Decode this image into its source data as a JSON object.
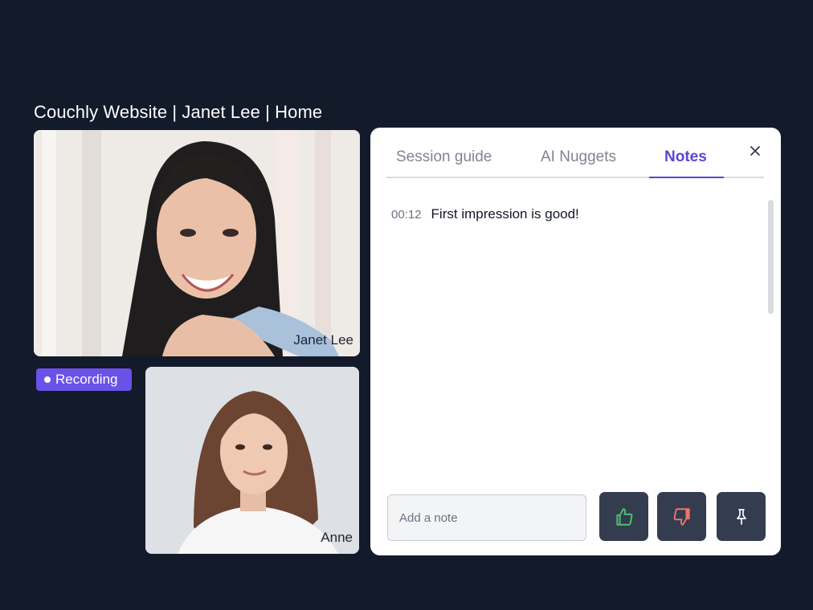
{
  "session": {
    "title": "Couchly Website | Janet Lee | Home"
  },
  "videos": {
    "main": {
      "name": "Janet Lee"
    },
    "small": {
      "name": "Anne"
    }
  },
  "recording": {
    "label": "Recording"
  },
  "panel": {
    "tabs": [
      {
        "label": "Session guide",
        "active": false
      },
      {
        "label": "AI Nuggets",
        "active": false
      },
      {
        "label": "Notes",
        "active": true
      }
    ],
    "notes": [
      {
        "time": "00:12",
        "text": "First impression is good!"
      }
    ],
    "input": {
      "placeholder": "Add a note",
      "value": ""
    },
    "icons": {
      "close": "close-icon",
      "thumbs_up": "thumbs-up-icon",
      "thumbs_down": "thumbs-down-icon",
      "pin": "pin-icon"
    }
  },
  "colors": {
    "background": "#131a2a",
    "accent": "#5b46d6",
    "recording": "#6a52e8",
    "button": "#343c4f",
    "thumbs_up": "#4cc46c",
    "thumbs_down": "#f0726a"
  }
}
